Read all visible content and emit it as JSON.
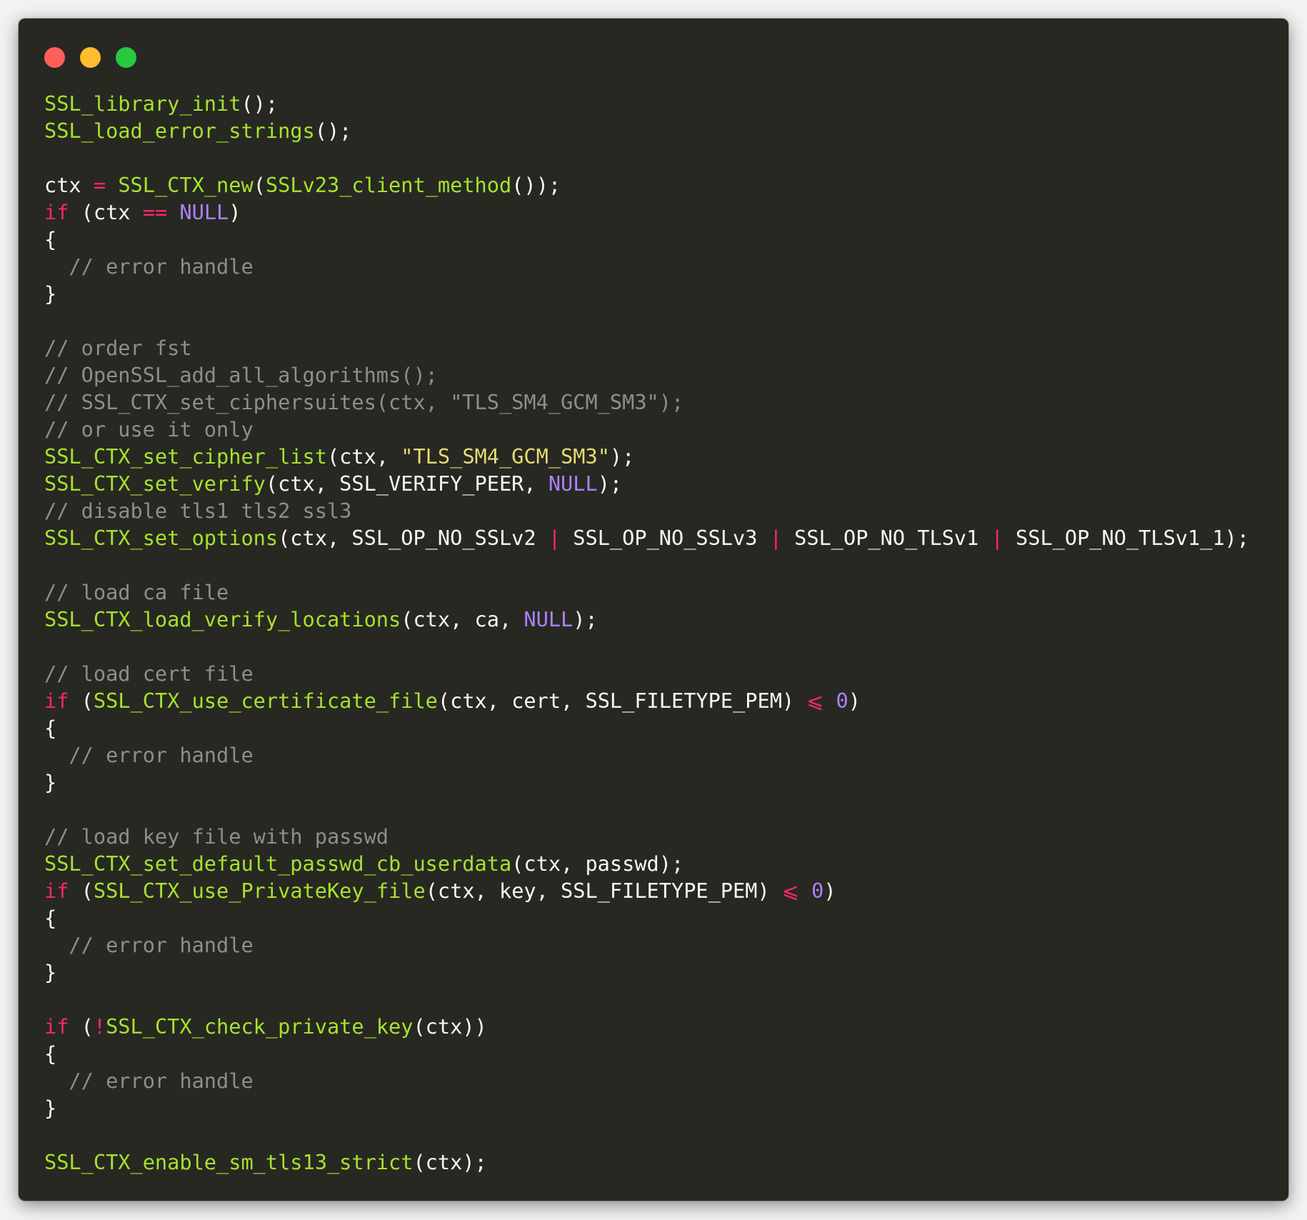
{
  "window": {
    "controls": [
      {
        "name": "close",
        "color": "#ff5f56"
      },
      {
        "name": "minimize",
        "color": "#ffbd2e"
      },
      {
        "name": "zoom",
        "color": "#27c93f"
      }
    ]
  },
  "theme": {
    "background": "#272822",
    "text": "#f8f8f2",
    "function": "#a6e22e",
    "keyword": "#f92672",
    "constant": "#ae81ff",
    "string": "#e6db74",
    "comment": "#8f8f87"
  },
  "code": {
    "lines": [
      [
        {
          "t": "fn",
          "v": "SSL_library_init"
        },
        {
          "t": "pn",
          "v": "();"
        }
      ],
      [
        {
          "t": "fn",
          "v": "SSL_load_error_strings"
        },
        {
          "t": "pn",
          "v": "();"
        }
      ],
      [],
      [
        {
          "t": "id",
          "v": "ctx "
        },
        {
          "t": "op",
          "v": "="
        },
        {
          "t": "id",
          "v": " "
        },
        {
          "t": "fn",
          "v": "SSL_CTX_new"
        },
        {
          "t": "pn",
          "v": "("
        },
        {
          "t": "fn",
          "v": "SSLv23_client_method"
        },
        {
          "t": "pn",
          "v": "());"
        }
      ],
      [
        {
          "t": "kw",
          "v": "if"
        },
        {
          "t": "pn",
          "v": " (ctx "
        },
        {
          "t": "op",
          "v": "=="
        },
        {
          "t": "pn",
          "v": " "
        },
        {
          "t": "cst",
          "v": "NULL"
        },
        {
          "t": "pn",
          "v": ")"
        }
      ],
      [
        {
          "t": "pn",
          "v": "{"
        }
      ],
      [
        {
          "t": "cm",
          "v": "  // error handle"
        }
      ],
      [
        {
          "t": "pn",
          "v": "}"
        }
      ],
      [],
      [
        {
          "t": "cm",
          "v": "// order fst"
        }
      ],
      [
        {
          "t": "cm",
          "v": "// OpenSSL_add_all_algorithms();"
        }
      ],
      [
        {
          "t": "cm",
          "v": "// SSL_CTX_set_ciphersuites(ctx, \"TLS_SM4_GCM_SM3\");"
        }
      ],
      [
        {
          "t": "cm",
          "v": "// or use it only"
        }
      ],
      [
        {
          "t": "fn",
          "v": "SSL_CTX_set_cipher_list"
        },
        {
          "t": "pn",
          "v": "(ctx, "
        },
        {
          "t": "str",
          "v": "\"TLS_SM4_GCM_SM3\""
        },
        {
          "t": "pn",
          "v": ");"
        }
      ],
      [
        {
          "t": "fn",
          "v": "SSL_CTX_set_verify"
        },
        {
          "t": "pn",
          "v": "(ctx, SSL_VERIFY_PEER, "
        },
        {
          "t": "cst",
          "v": "NULL"
        },
        {
          "t": "pn",
          "v": ");"
        }
      ],
      [
        {
          "t": "cm",
          "v": "// disable tls1 tls2 ssl3"
        }
      ],
      [
        {
          "t": "fn",
          "v": "SSL_CTX_set_options"
        },
        {
          "t": "pn",
          "v": "(ctx, SSL_OP_NO_SSLv2 "
        },
        {
          "t": "op",
          "v": "|"
        },
        {
          "t": "pn",
          "v": " SSL_OP_NO_SSLv3 "
        },
        {
          "t": "op",
          "v": "|"
        },
        {
          "t": "pn",
          "v": " SSL_OP_NO_TLSv1 "
        },
        {
          "t": "op",
          "v": "|"
        },
        {
          "t": "pn",
          "v": " SSL_OP_NO_TLSv1_1);"
        }
      ],
      [],
      [
        {
          "t": "cm",
          "v": "// load ca file"
        }
      ],
      [
        {
          "t": "fn",
          "v": "SSL_CTX_load_verify_locations"
        },
        {
          "t": "pn",
          "v": "(ctx, ca, "
        },
        {
          "t": "cst",
          "v": "NULL"
        },
        {
          "t": "pn",
          "v": ");"
        }
      ],
      [],
      [
        {
          "t": "cm",
          "v": "// load cert file"
        }
      ],
      [
        {
          "t": "kw",
          "v": "if"
        },
        {
          "t": "pn",
          "v": " ("
        },
        {
          "t": "fn",
          "v": "SSL_CTX_use_certificate_file"
        },
        {
          "t": "pn",
          "v": "(ctx, cert, SSL_FILETYPE_PEM) "
        },
        {
          "t": "op",
          "v": "⩽"
        },
        {
          "t": "pn",
          "v": " "
        },
        {
          "t": "cst",
          "v": "0"
        },
        {
          "t": "pn",
          "v": ")"
        }
      ],
      [
        {
          "t": "pn",
          "v": "{"
        }
      ],
      [
        {
          "t": "cm",
          "v": "  // error handle"
        }
      ],
      [
        {
          "t": "pn",
          "v": "}"
        }
      ],
      [],
      [
        {
          "t": "cm",
          "v": "// load key file with passwd"
        }
      ],
      [
        {
          "t": "fn",
          "v": "SSL_CTX_set_default_passwd_cb_userdata"
        },
        {
          "t": "pn",
          "v": "(ctx, passwd);"
        }
      ],
      [
        {
          "t": "kw",
          "v": "if"
        },
        {
          "t": "pn",
          "v": " ("
        },
        {
          "t": "fn",
          "v": "SSL_CTX_use_PrivateKey_file"
        },
        {
          "t": "pn",
          "v": "(ctx, key, SSL_FILETYPE_PEM) "
        },
        {
          "t": "op",
          "v": "⩽"
        },
        {
          "t": "pn",
          "v": " "
        },
        {
          "t": "cst",
          "v": "0"
        },
        {
          "t": "pn",
          "v": ")"
        }
      ],
      [
        {
          "t": "pn",
          "v": "{"
        }
      ],
      [
        {
          "t": "cm",
          "v": "  // error handle"
        }
      ],
      [
        {
          "t": "pn",
          "v": "}"
        }
      ],
      [],
      [
        {
          "t": "kw",
          "v": "if"
        },
        {
          "t": "pn",
          "v": " ("
        },
        {
          "t": "op",
          "v": "!"
        },
        {
          "t": "fn",
          "v": "SSL_CTX_check_private_key"
        },
        {
          "t": "pn",
          "v": "(ctx))"
        }
      ],
      [
        {
          "t": "pn",
          "v": "{"
        }
      ],
      [
        {
          "t": "cm",
          "v": "  // error handle"
        }
      ],
      [
        {
          "t": "pn",
          "v": "}"
        }
      ],
      [],
      [
        {
          "t": "fn",
          "v": "SSL_CTX_enable_sm_tls13_strict"
        },
        {
          "t": "pn",
          "v": "(ctx);"
        }
      ]
    ]
  }
}
